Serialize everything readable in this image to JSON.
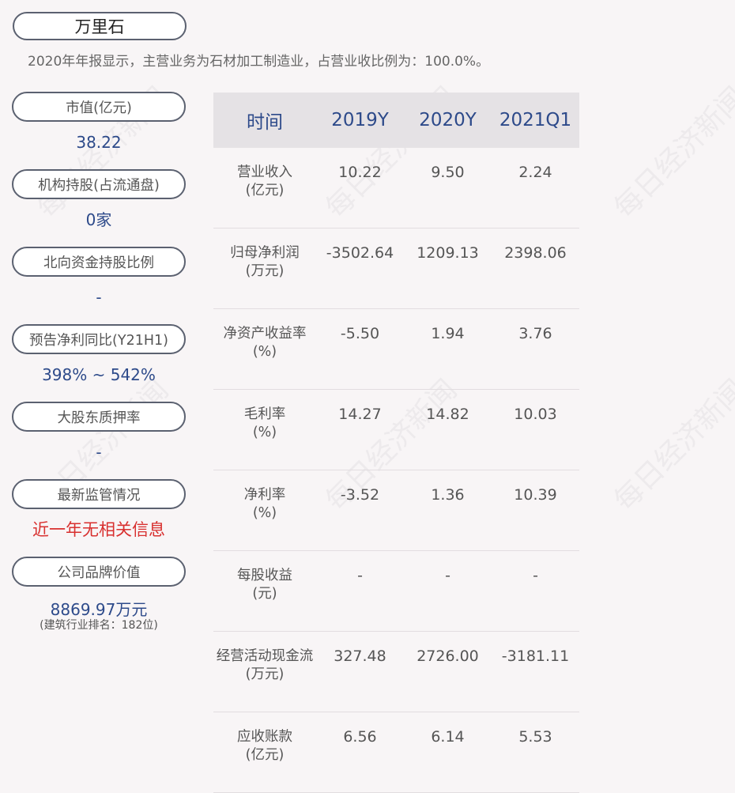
{
  "company": "万里石",
  "summary": "2020年年报显示，主营业务为石材加工制造业，占营业收比例为：100.0%。",
  "watermark": "每日经济新闻",
  "metrics": [
    {
      "label": "市值(亿元)",
      "value": "38.22"
    },
    {
      "label": "机构持股(占流通盘)",
      "value": "0家"
    },
    {
      "label": "北向资金持股比例",
      "value": "-"
    },
    {
      "label": "预告净利同比(Y21H1)",
      "value": "398% ~ 542%"
    },
    {
      "label": "大股东质押率",
      "value": "-"
    },
    {
      "label": "最新监管情况",
      "value": "近一年无相关信息"
    },
    {
      "label": "公司品牌价值",
      "value": "8869.97万元",
      "note": "(建筑行业排名：182位)"
    }
  ],
  "table": {
    "headers": [
      "时间",
      "2019Y",
      "2020Y",
      "2021Q1"
    ],
    "rows": [
      {
        "label": [
          "营业收入",
          "(亿元)"
        ],
        "values": [
          "10.22",
          "9.50",
          "2.24"
        ]
      },
      {
        "label": [
          "归母净利润",
          "(万元)"
        ],
        "values": [
          "-3502.64",
          "1209.13",
          "2398.06"
        ]
      },
      {
        "label": [
          "净资产收益率",
          "(%)"
        ],
        "values": [
          "-5.50",
          "1.94",
          "3.76"
        ]
      },
      {
        "label": [
          "毛利率",
          "(%)"
        ],
        "values": [
          "14.27",
          "14.82",
          "10.03"
        ]
      },
      {
        "label": [
          "净利率",
          "(%)"
        ],
        "values": [
          "-3.52",
          "1.36",
          "10.39"
        ]
      },
      {
        "label": [
          "每股收益",
          "(元)"
        ],
        "values": [
          "-",
          "-",
          "-"
        ]
      },
      {
        "label": [
          "经营活动现金流",
          "(万元)"
        ],
        "values": [
          "327.48",
          "2726.00",
          "-3181.11"
        ]
      },
      {
        "label": [
          "应收账款",
          "(亿元)"
        ],
        "values": [
          "6.56",
          "6.14",
          "5.53"
        ]
      }
    ]
  },
  "colors": {
    "accent": "#2d4a8a",
    "alert": "#d8302f",
    "background": "#f8f5f6"
  }
}
